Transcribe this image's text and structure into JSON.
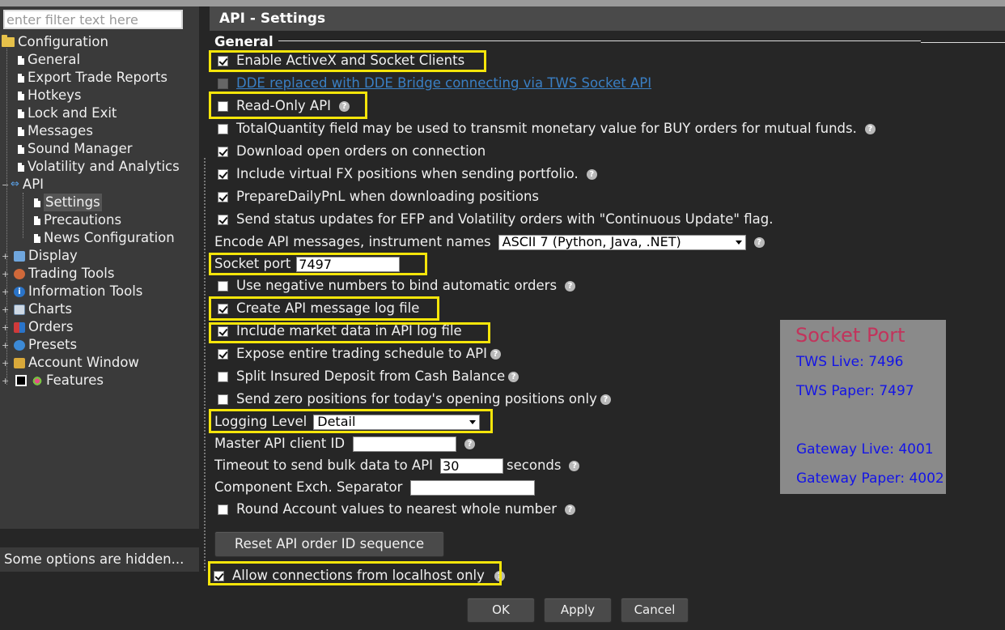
{
  "filter": {
    "placeholder": "enter filter text here"
  },
  "tree": {
    "root": "Configuration",
    "items": [
      "General",
      "Export Trade Reports",
      "Hotkeys",
      "Lock and Exit",
      "Messages",
      "Sound Manager",
      "Volatility and Analytics"
    ],
    "api": {
      "label": "API",
      "children": [
        "Settings",
        "Precautions",
        "News Configuration"
      ]
    },
    "categories": [
      "Display",
      "Trading Tools",
      "Information Tools",
      "Charts",
      "Orders",
      "Presets",
      "Account Window",
      "Features"
    ]
  },
  "hidden_notice": "Some options are hidden...",
  "header": {
    "title": "API - Settings"
  },
  "section": {
    "title": "General"
  },
  "options": {
    "enable_activex": "Enable ActiveX and Socket Clients",
    "dde_replaced": "DDE replaced with DDE Bridge connecting via TWS Socket API",
    "read_only_api": "Read-Only API",
    "total_quantity": "TotalQuantity field may be used to transmit monetary value for BUY orders for mutual funds.",
    "download_open_orders": "Download open orders on connection",
    "include_virtual_fx": "Include virtual FX positions when sending portfolio.",
    "prepare_daily_pnl": "PrepareDailyPnL when downloading positions",
    "send_status_updates": "Send status updates for EFP and Volatility orders with \"Continuous Update\" flag.",
    "encode_label": "Encode API messages, instrument names",
    "encode_value": "ASCII 7 (Python, Java, .NET)",
    "socket_port_label": "Socket port",
    "socket_port_value": "7497",
    "negative_numbers": "Use negative numbers to bind automatic orders",
    "create_log": "Create API message log file",
    "include_market_data": "Include market data in API log file",
    "expose_schedule": "Expose entire trading schedule to API",
    "split_insured": "Split Insured Deposit from Cash Balance",
    "send_zero_positions": "Send zero positions for today's opening positions only",
    "logging_label": "Logging Level",
    "logging_value": "Detail",
    "master_client_label": "Master API client ID",
    "master_client_value": "",
    "timeout_label": "Timeout to send bulk data to API",
    "timeout_value": "30",
    "timeout_unit": "seconds",
    "component_label": "Component Exch. Separator",
    "component_value": "",
    "round_account": "Round Account values to nearest whole number",
    "reset_button": "Reset API order ID sequence",
    "allow_localhost": "Allow connections from localhost only"
  },
  "help_glyph": "?",
  "buttons": {
    "ok": "OK",
    "apply": "Apply",
    "cancel": "Cancel"
  },
  "note": {
    "title": "Socket Port",
    "lines": [
      "TWS Live: 7496",
      "TWS Paper:  7497",
      "Gateway Live: 4001",
      "Gateway Paper: 4002"
    ]
  },
  "colors": {
    "highlight": "#f5e50a",
    "note_title": "#c2345c",
    "note_text": "#1414e6",
    "link": "#3a7fc4"
  }
}
